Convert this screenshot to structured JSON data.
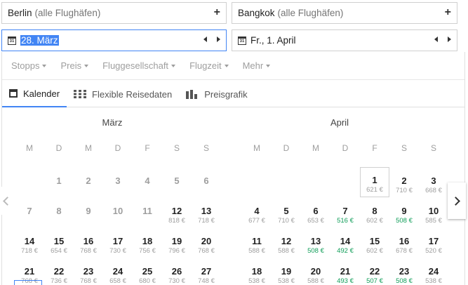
{
  "search": {
    "origin": {
      "city": "Berlin",
      "sub": "(alle Flughäfen)"
    },
    "destination": {
      "city": "Bangkok",
      "sub": "(alle Flughäfen)"
    },
    "add_symbol": "+",
    "depart_date": "28. März",
    "return_date": "Fr., 1. April",
    "calendar_glyph": "31"
  },
  "filters": [
    "Stopps",
    "Preis",
    "Fluggesellschaft",
    "Flugzeit",
    "Mehr"
  ],
  "tabs": [
    {
      "label": "Kalender",
      "icon": "calendar-icon",
      "active": true
    },
    {
      "label": "Flexible Reisedaten",
      "icon": "grid-icon",
      "active": false
    },
    {
      "label": "Preisgrafik",
      "icon": "bar-chart-icon",
      "active": false
    }
  ],
  "colors": {
    "accent": "#4285f4",
    "low_price": "#0f9d58",
    "muted": "#9e9e9e"
  },
  "months": [
    {
      "name": "März",
      "dow": [
        "M",
        "D",
        "M",
        "D",
        "F",
        "S",
        "S"
      ],
      "rows": [
        [
          null,
          {
            "d": "1",
            "past": true
          },
          {
            "d": "2",
            "past": true
          },
          {
            "d": "3",
            "past": true
          },
          {
            "d": "4",
            "past": true
          },
          {
            "d": "5",
            "past": true
          },
          {
            "d": "6",
            "past": true
          }
        ],
        [
          {
            "d": "7",
            "past": true
          },
          {
            "d": "8",
            "past": true
          },
          {
            "d": "9",
            "past": true
          },
          {
            "d": "10",
            "past": true
          },
          {
            "d": "11",
            "past": true
          },
          {
            "d": "12",
            "p": "818 €"
          },
          {
            "d": "13",
            "p": "718 €"
          }
        ],
        [
          {
            "d": "14",
            "p": "718 €"
          },
          {
            "d": "15",
            "p": "654 €"
          },
          {
            "d": "16",
            "p": "768 €"
          },
          {
            "d": "17",
            "p": "730 €"
          },
          {
            "d": "18",
            "p": "756 €"
          },
          {
            "d": "19",
            "p": "796 €"
          },
          {
            "d": "20",
            "p": "768 €"
          }
        ],
        [
          {
            "d": "21",
            "p": "768 €"
          },
          {
            "d": "22",
            "p": "736 €"
          },
          {
            "d": "23",
            "p": "768 €"
          },
          {
            "d": "24",
            "p": "658 €"
          },
          {
            "d": "25",
            "p": "680 €"
          },
          {
            "d": "26",
            "p": "730 €"
          },
          {
            "d": "27",
            "p": "748 €"
          }
        ]
      ]
    },
    {
      "name": "April",
      "dow": [
        "M",
        "D",
        "M",
        "D",
        "F",
        "S",
        "S"
      ],
      "rows": [
        [
          null,
          null,
          null,
          null,
          {
            "d": "1",
            "p": "621 €",
            "boxed": true
          },
          {
            "d": "2",
            "p": "710 €"
          },
          {
            "d": "3",
            "p": "668 €"
          }
        ],
        [
          {
            "d": "4",
            "p": "677 €"
          },
          {
            "d": "5",
            "p": "710 €"
          },
          {
            "d": "6",
            "p": "653 €"
          },
          {
            "d": "7",
            "p": "516 €",
            "low": true
          },
          {
            "d": "8",
            "p": "602 €"
          },
          {
            "d": "9",
            "p": "508 €",
            "low": true
          },
          {
            "d": "10",
            "p": "585 €"
          }
        ],
        [
          {
            "d": "11",
            "p": "588 €"
          },
          {
            "d": "12",
            "p": "588 €"
          },
          {
            "d": "13",
            "p": "508 €",
            "low": true
          },
          {
            "d": "14",
            "p": "492 €",
            "low": true
          },
          {
            "d": "15",
            "p": "602 €"
          },
          {
            "d": "16",
            "p": "678 €"
          },
          {
            "d": "17",
            "p": "520 €"
          }
        ],
        [
          {
            "d": "18",
            "p": "538 €"
          },
          {
            "d": "19",
            "p": "538 €"
          },
          {
            "d": "20",
            "p": "588 €"
          },
          {
            "d": "21",
            "p": "493 €",
            "low": true
          },
          {
            "d": "22",
            "p": "507 €",
            "low": true
          },
          {
            "d": "23",
            "p": "508 €",
            "low": true
          },
          {
            "d": "24",
            "p": "538 €"
          }
        ]
      ]
    }
  ]
}
